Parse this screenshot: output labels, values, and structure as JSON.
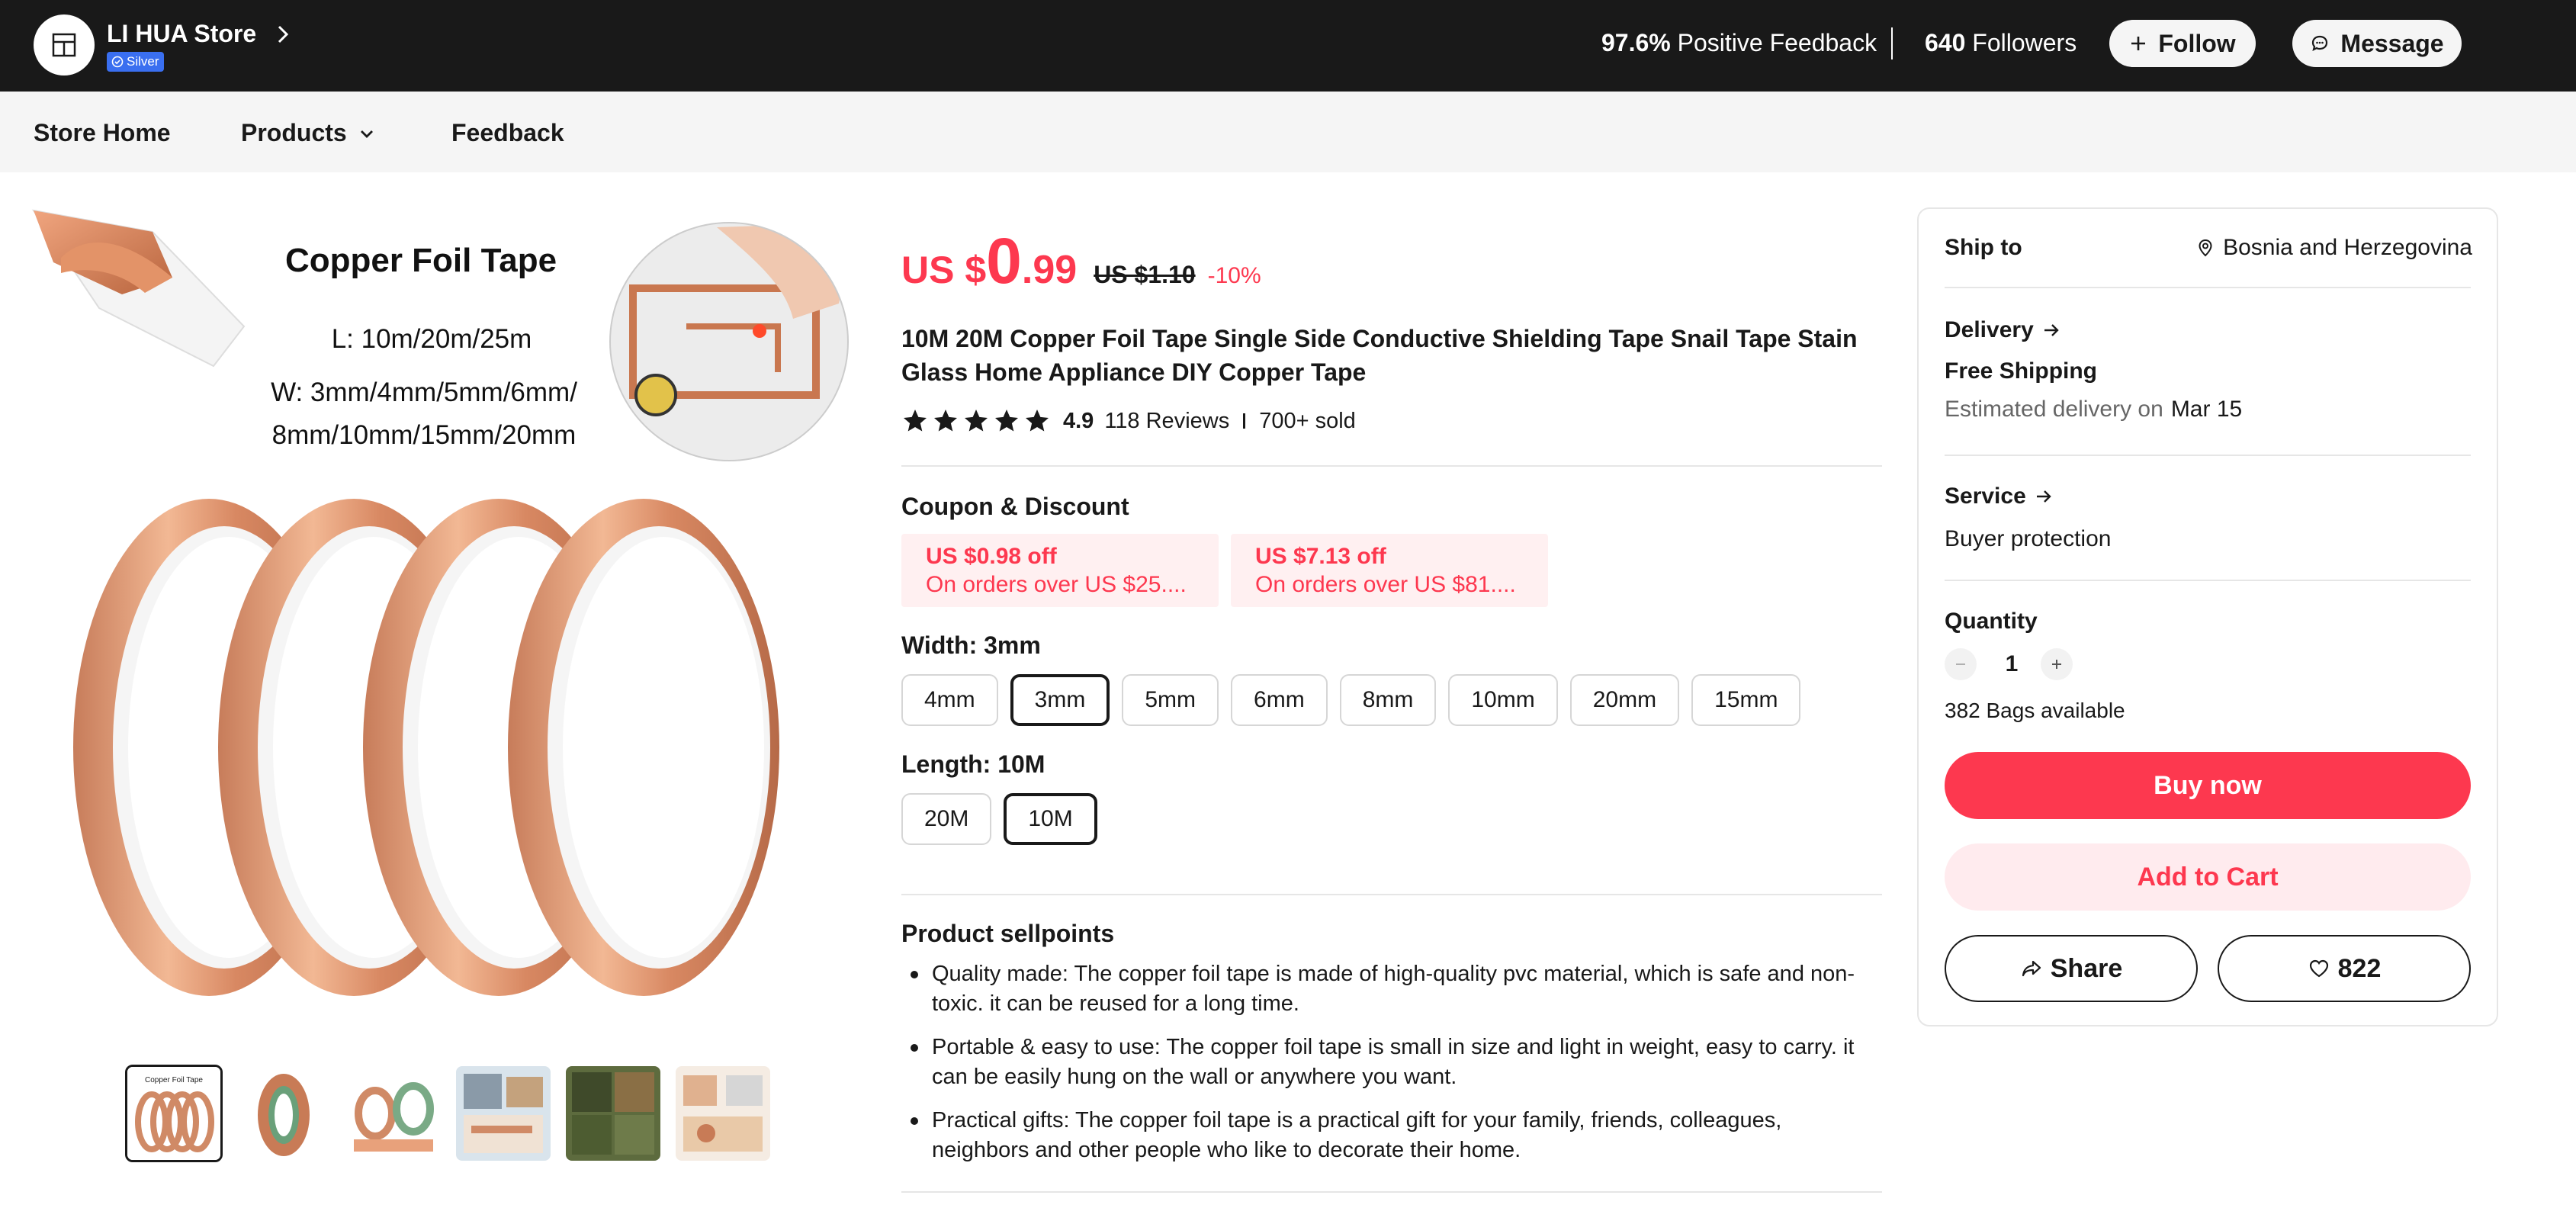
{
  "store": {
    "name": "LI HUA Store",
    "badge": "Silver",
    "feedback_pct": "97.6%",
    "feedback_label": "Positive Feedback",
    "followers": "640",
    "followers_label": "Followers",
    "follow_label": "Follow",
    "message_label": "Message"
  },
  "nav": {
    "home": "Store Home",
    "products": "Products",
    "feedback": "Feedback"
  },
  "gallery": {
    "heading": "Copper Foil Tape",
    "length_line": "L: 10m/20m/25m",
    "width_line1": "W: 3mm/4mm/5mm/6mm/",
    "width_line2": "8mm/10mm/15mm/20mm",
    "thumbnails": 6,
    "selected_thumbnail": 1,
    "thumb_caption": "Copper Foil Tape"
  },
  "product": {
    "currency": "US $",
    "price_int": "0",
    "price_cents": ".99",
    "original_price": "US $1.10",
    "discount": "-10%",
    "title": "10M 20M Copper Foil Tape Single Side Conductive Shielding Tape Snail Tape Stain Glass Home Appliance DIY Copper Tape",
    "rating": "4.9",
    "rating_stars": 5,
    "reviews": "118 Reviews",
    "sold": "700+ sold"
  },
  "coupons": {
    "label": "Coupon & Discount",
    "items": [
      {
        "amount": "US $0.98 off",
        "condition": "On orders over US $25...."
      },
      {
        "amount": "US $7.13 off",
        "condition": "On orders over US $81...."
      }
    ]
  },
  "width_option": {
    "label": "Width: 3mm",
    "options": [
      "4mm",
      "3mm",
      "5mm",
      "6mm",
      "8mm",
      "10mm",
      "20mm",
      "15mm"
    ],
    "selected": "3mm"
  },
  "length_option": {
    "label": "Length: 10M",
    "options": [
      "20M",
      "10M"
    ],
    "selected": "10M"
  },
  "sellpoints": {
    "title": "Product sellpoints",
    "items": [
      "Quality made: The copper foil tape is made of high-quality pvc material, which is safe and non-toxic. it can be reused for a long time.",
      "Portable & easy to use: The copper foil tape is small in size and light in weight, easy to carry. it can be easily hung on the wall or anywhere you want.",
      "Practical gifts: The copper foil tape is a practical gift for your family, friends, colleagues, neighbors and other people who like to decorate their home."
    ]
  },
  "panel": {
    "ship_to_label": "Ship to",
    "ship_to_value": "Bosnia and Herzegovina",
    "delivery_label": "Delivery",
    "shipping": "Free Shipping",
    "estimate_prefix": "Estimated delivery on",
    "estimate_date": "Mar 15",
    "service_label": "Service",
    "service_value": "Buyer protection",
    "quantity_label": "Quantity",
    "quantity": "1",
    "available": "382 Bags available",
    "buy_label": "Buy now",
    "cart_label": "Add to Cart",
    "share_label": "Share",
    "wishlist_count": "822"
  },
  "colors": {
    "accent": "#fd384f",
    "dark_bar": "#191919",
    "copper": "#d9906b"
  },
  "icons": [
    "store-icon",
    "chevron-right-icon",
    "verified-icon",
    "plus-icon",
    "chat-bubble-icon",
    "chevron-down-icon",
    "star-icon",
    "location-pin-icon",
    "arrow-right-icon",
    "minus-icon",
    "share-icon",
    "heart-icon"
  ]
}
